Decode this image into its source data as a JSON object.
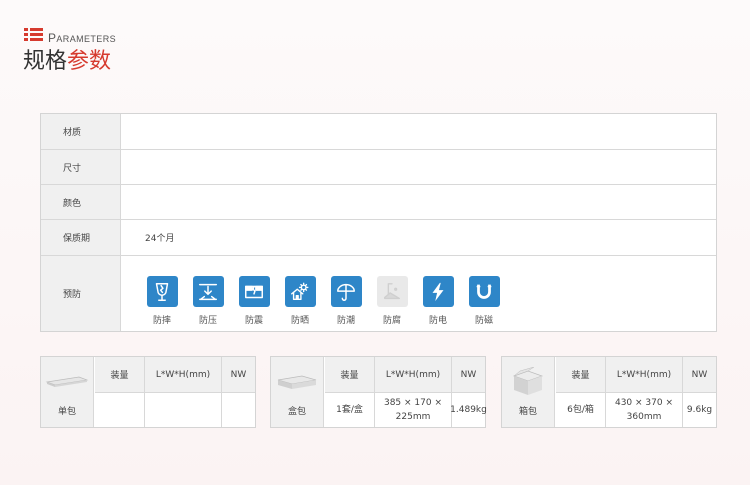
{
  "header": {
    "subtitle_first": "P",
    "subtitle_rest": "arameters",
    "title_part1": "规格",
    "title_part2": "参数"
  },
  "params": {
    "material_label": "材质",
    "size_label": "尺寸",
    "color_label": "颜色",
    "warranty_label": "保质期",
    "warranty_value": "24个月",
    "prevention_label": "预防"
  },
  "protections": [
    {
      "label": "防摔",
      "icon": "broken-glass-icon",
      "active": true
    },
    {
      "label": "防压",
      "icon": "press-down-icon",
      "active": true
    },
    {
      "label": "防震",
      "icon": "shockproof-icon",
      "active": true
    },
    {
      "label": "防晒",
      "icon": "sun-house-icon",
      "active": true
    },
    {
      "label": "防潮",
      "icon": "umbrella-icon",
      "active": true
    },
    {
      "label": "防腐",
      "icon": "anticorrosion-icon",
      "active": false
    },
    {
      "label": "防电",
      "icon": "lightning-icon",
      "active": true
    },
    {
      "label": "防磁",
      "icon": "magnet-icon",
      "active": true
    }
  ],
  "packages": [
    {
      "name": "单包",
      "qty_header": "装量",
      "dim_header": "L*W*H(mm)",
      "nw_header": "NW",
      "qty": "",
      "dim_line1": "",
      "dim_line2": "",
      "nw": ""
    },
    {
      "name": "盒包",
      "qty_header": "装量",
      "dim_header": "L*W*H(mm)",
      "nw_header": "NW",
      "qty": "1套/盒",
      "dim_line1": "385 × 170 ×",
      "dim_line2": "225mm",
      "nw": "1.489kg"
    },
    {
      "name": "箱包",
      "qty_header": "装量",
      "dim_header": "L*W*H(mm)",
      "nw_header": "NW",
      "qty": "6包/箱",
      "dim_line1": "430 × 370 ×",
      "dim_line2": "360mm",
      "nw": "9.6kg"
    }
  ],
  "colors": {
    "accent": "#d63a2e",
    "icon_blue": "#2e86c8",
    "label_bg": "#f0f0f0"
  }
}
